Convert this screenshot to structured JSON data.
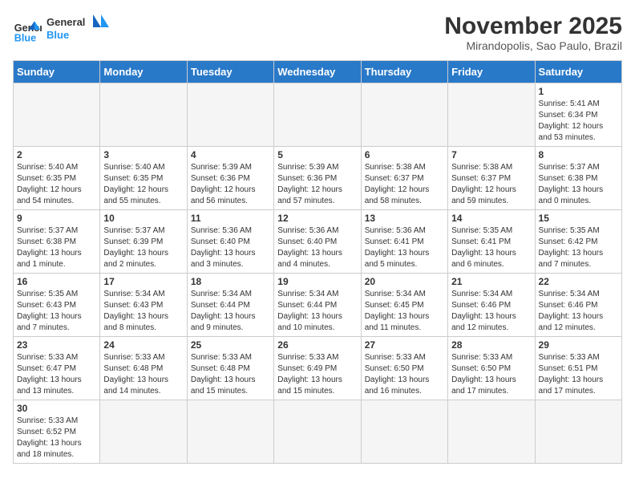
{
  "logo": {
    "text_general": "General",
    "text_blue": "Blue"
  },
  "header": {
    "month": "November 2025",
    "location": "Mirandopolis, Sao Paulo, Brazil"
  },
  "weekdays": [
    "Sunday",
    "Monday",
    "Tuesday",
    "Wednesday",
    "Thursday",
    "Friday",
    "Saturday"
  ],
  "days": {
    "1": {
      "sunrise": "5:41 AM",
      "sunset": "6:34 PM",
      "daylight": "12 hours and 53 minutes."
    },
    "2": {
      "sunrise": "5:40 AM",
      "sunset": "6:35 PM",
      "daylight": "12 hours and 54 minutes."
    },
    "3": {
      "sunrise": "5:40 AM",
      "sunset": "6:35 PM",
      "daylight": "12 hours and 55 minutes."
    },
    "4": {
      "sunrise": "5:39 AM",
      "sunset": "6:36 PM",
      "daylight": "12 hours and 56 minutes."
    },
    "5": {
      "sunrise": "5:39 AM",
      "sunset": "6:36 PM",
      "daylight": "12 hours and 57 minutes."
    },
    "6": {
      "sunrise": "5:38 AM",
      "sunset": "6:37 PM",
      "daylight": "12 hours and 58 minutes."
    },
    "7": {
      "sunrise": "5:38 AM",
      "sunset": "6:37 PM",
      "daylight": "12 hours and 59 minutes."
    },
    "8": {
      "sunrise": "5:37 AM",
      "sunset": "6:38 PM",
      "daylight": "13 hours and 0 minutes."
    },
    "9": {
      "sunrise": "5:37 AM",
      "sunset": "6:38 PM",
      "daylight": "13 hours and 1 minute."
    },
    "10": {
      "sunrise": "5:37 AM",
      "sunset": "6:39 PM",
      "daylight": "13 hours and 2 minutes."
    },
    "11": {
      "sunrise": "5:36 AM",
      "sunset": "6:40 PM",
      "daylight": "13 hours and 3 minutes."
    },
    "12": {
      "sunrise": "5:36 AM",
      "sunset": "6:40 PM",
      "daylight": "13 hours and 4 minutes."
    },
    "13": {
      "sunrise": "5:36 AM",
      "sunset": "6:41 PM",
      "daylight": "13 hours and 5 minutes."
    },
    "14": {
      "sunrise": "5:35 AM",
      "sunset": "6:41 PM",
      "daylight": "13 hours and 6 minutes."
    },
    "15": {
      "sunrise": "5:35 AM",
      "sunset": "6:42 PM",
      "daylight": "13 hours and 7 minutes."
    },
    "16": {
      "sunrise": "5:35 AM",
      "sunset": "6:43 PM",
      "daylight": "13 hours and 7 minutes."
    },
    "17": {
      "sunrise": "5:34 AM",
      "sunset": "6:43 PM",
      "daylight": "13 hours and 8 minutes."
    },
    "18": {
      "sunrise": "5:34 AM",
      "sunset": "6:44 PM",
      "daylight": "13 hours and 9 minutes."
    },
    "19": {
      "sunrise": "5:34 AM",
      "sunset": "6:44 PM",
      "daylight": "13 hours and 10 minutes."
    },
    "20": {
      "sunrise": "5:34 AM",
      "sunset": "6:45 PM",
      "daylight": "13 hours and 11 minutes."
    },
    "21": {
      "sunrise": "5:34 AM",
      "sunset": "6:46 PM",
      "daylight": "13 hours and 12 minutes."
    },
    "22": {
      "sunrise": "5:34 AM",
      "sunset": "6:46 PM",
      "daylight": "13 hours and 12 minutes."
    },
    "23": {
      "sunrise": "5:33 AM",
      "sunset": "6:47 PM",
      "daylight": "13 hours and 13 minutes."
    },
    "24": {
      "sunrise": "5:33 AM",
      "sunset": "6:48 PM",
      "daylight": "13 hours and 14 minutes."
    },
    "25": {
      "sunrise": "5:33 AM",
      "sunset": "6:48 PM",
      "daylight": "13 hours and 15 minutes."
    },
    "26": {
      "sunrise": "5:33 AM",
      "sunset": "6:49 PM",
      "daylight": "13 hours and 15 minutes."
    },
    "27": {
      "sunrise": "5:33 AM",
      "sunset": "6:50 PM",
      "daylight": "13 hours and 16 minutes."
    },
    "28": {
      "sunrise": "5:33 AM",
      "sunset": "6:50 PM",
      "daylight": "13 hours and 17 minutes."
    },
    "29": {
      "sunrise": "5:33 AM",
      "sunset": "6:51 PM",
      "daylight": "13 hours and 17 minutes."
    },
    "30": {
      "sunrise": "5:33 AM",
      "sunset": "6:52 PM",
      "daylight": "13 hours and 18 minutes."
    }
  },
  "labels": {
    "sunrise": "Sunrise:",
    "sunset": "Sunset:",
    "daylight": "Daylight:"
  }
}
